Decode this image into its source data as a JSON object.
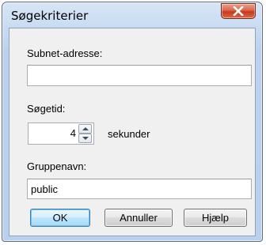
{
  "window": {
    "title": "Søgekriterier",
    "close_icon": "close-icon"
  },
  "form": {
    "subnet_label": "Subnet-adresse:",
    "subnet_value": "",
    "searchtime_label": "Søgetid:",
    "searchtime_value": "4",
    "searchtime_unit": "sekunder",
    "group_label": "Gruppenavn:",
    "group_value": "public"
  },
  "buttons": {
    "ok": "OK",
    "cancel": "Annuller",
    "help": "Hjælp"
  },
  "colors": {
    "close_button": "#c7391a",
    "default_button_border": "#3c7fb1"
  }
}
